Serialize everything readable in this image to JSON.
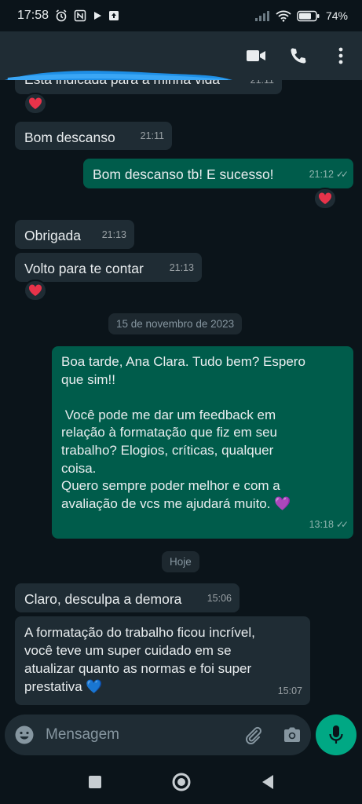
{
  "status_bar": {
    "time": "17:58",
    "battery": "74"
  },
  "header": {
    "icons": [
      "video-call-icon",
      "voice-call-icon",
      "more-options-icon"
    ]
  },
  "messages": [
    {
      "id": "m0",
      "dir": "in",
      "text": "Está indicada para a minha vida",
      "time": "21:11",
      "reaction": "heart"
    },
    {
      "id": "m1",
      "dir": "in",
      "text": "Bom descanso",
      "time": "21:11"
    },
    {
      "id": "m2",
      "dir": "out",
      "text": "Bom descanso tb! E sucesso!",
      "time": "21:12",
      "reaction": "heart"
    },
    {
      "id": "m3",
      "dir": "in",
      "text": "Obrigada",
      "time": "21:13"
    },
    {
      "id": "m4",
      "dir": "in",
      "text": "Volto para te contar",
      "time": "21:13",
      "reaction": "heart"
    },
    {
      "id": "m5",
      "dir": "out",
      "text_lines": [
        "Boa tarde, Ana Clara. Tudo bem? Espero",
        "que sim!!",
        "",
        " Você pode me dar um feedback em",
        "relação à formatação que fiz em seu",
        "trabalho? Elogios, críticas, qualquer",
        "coisa.",
        "Quero sempre poder melhor e com a",
        "avaliação de vcs me ajudará muito. 💜"
      ],
      "time": "13:18"
    },
    {
      "id": "m6",
      "dir": "in",
      "text": "Claro, desculpa a demora",
      "time": "15:06"
    },
    {
      "id": "m7",
      "dir": "in",
      "text_lines": [
        "A formatação do trabalho ficou incrível,",
        "você teve um super cuidado em se",
        "atualizar quanto as normas e foi super",
        "prestativa 💙"
      ],
      "time": "15:07"
    }
  ],
  "date_separators": {
    "first": "15 de novembro de 2023",
    "second": "Hoje"
  },
  "composer": {
    "placeholder": "Mensagem"
  },
  "colors": {
    "incoming": "#1f2c34",
    "outgoing": "#005c4b",
    "accent": "#00a884",
    "heart": "#e8334a"
  }
}
